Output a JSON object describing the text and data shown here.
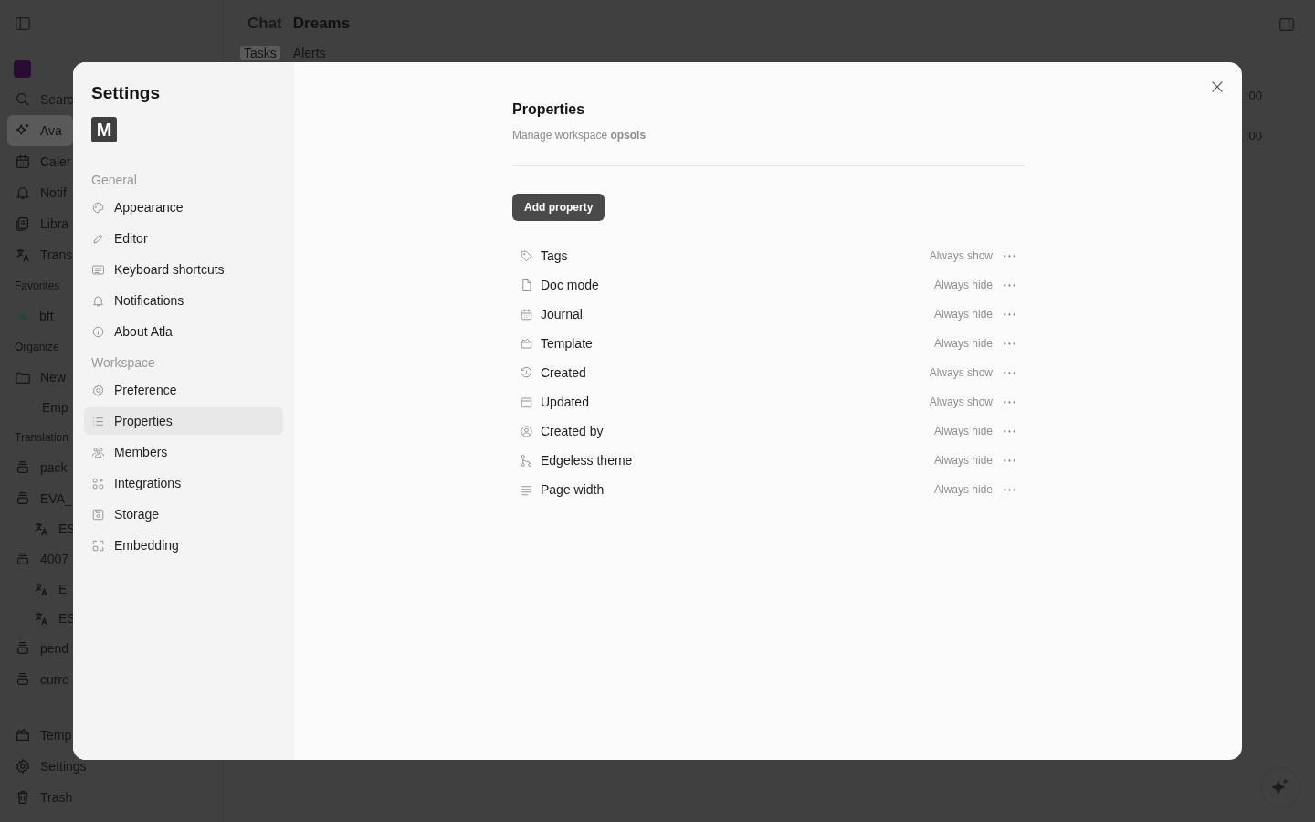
{
  "app": {
    "header": {
      "breadcrumb": "Chat",
      "title": "Dreams"
    },
    "tabs": [
      {
        "label": "Tasks",
        "selected": true
      },
      {
        "label": "Alerts",
        "selected": false
      }
    ],
    "timeline": [
      ":00",
      ":00"
    ],
    "sidebar": [
      {
        "kind": "item",
        "label": "Searc",
        "selected": false
      },
      {
        "kind": "item",
        "label": "Ava",
        "selected": true
      },
      {
        "kind": "item",
        "label": "Caler",
        "selected": false
      },
      {
        "kind": "item",
        "label": "Notif",
        "selected": false
      },
      {
        "kind": "item",
        "label": "Libra",
        "selected": false
      },
      {
        "kind": "item",
        "label": "Trans",
        "selected": false
      },
      {
        "kind": "section",
        "label": "Favorites"
      },
      {
        "kind": "dot",
        "label": "bft",
        "selected": false
      },
      {
        "kind": "section",
        "label": "Organize"
      },
      {
        "kind": "item",
        "label": "New",
        "selected": false
      },
      {
        "kind": "empty",
        "label": "Emp"
      },
      {
        "kind": "section",
        "label": "Translation"
      },
      {
        "kind": "item",
        "label": "pack",
        "selected": false
      },
      {
        "kind": "item",
        "label": "EVA_",
        "selected": false
      },
      {
        "kind": "subitem",
        "label": "ES",
        "selected": false
      },
      {
        "kind": "item",
        "label": "4007",
        "selected": false
      },
      {
        "kind": "subitem",
        "label": "E",
        "selected": false
      },
      {
        "kind": "subitem",
        "label": "ES",
        "selected": false
      },
      {
        "kind": "item",
        "label": "pend",
        "selected": false
      },
      {
        "kind": "item",
        "label": "curre",
        "selected": false
      }
    ],
    "sidebar_bottom": [
      "Temp",
      "Settings",
      "Trash"
    ]
  },
  "settings": {
    "title": "Settings",
    "avatar": "M",
    "nav": [
      {
        "heading": "General",
        "items": [
          {
            "label": "Appearance",
            "selected": false
          },
          {
            "label": "Editor",
            "selected": false
          },
          {
            "label": "Keyboard shortcuts",
            "selected": false
          },
          {
            "label": "Notifications",
            "selected": false
          },
          {
            "label": "About Atla",
            "selected": false
          }
        ]
      },
      {
        "heading": "Workspace",
        "items": [
          {
            "label": "Preference",
            "selected": false
          },
          {
            "label": "Properties",
            "selected": true
          },
          {
            "label": "Members",
            "selected": false
          },
          {
            "label": "Integrations",
            "selected": false
          },
          {
            "label": "Storage",
            "selected": false
          },
          {
            "label": "Embedding",
            "selected": false
          }
        ]
      }
    ],
    "page": {
      "title": "Properties",
      "subtitle": "Manage workspace **opsols**",
      "button": "Add property",
      "properties": [
        {
          "name": "Tags",
          "visibility": "Always show"
        },
        {
          "name": "Doc mode",
          "visibility": "Always hide"
        },
        {
          "name": "Journal",
          "visibility": "Always hide"
        },
        {
          "name": "Template",
          "visibility": "Always hide"
        },
        {
          "name": "Created",
          "visibility": "Always show"
        },
        {
          "name": "Updated",
          "visibility": "Always show"
        },
        {
          "name": "Created by",
          "visibility": "Always hide"
        },
        {
          "name": "Edgeless theme",
          "visibility": "Always hide"
        },
        {
          "name": "Page width",
          "visibility": "Always hide"
        }
      ]
    }
  }
}
